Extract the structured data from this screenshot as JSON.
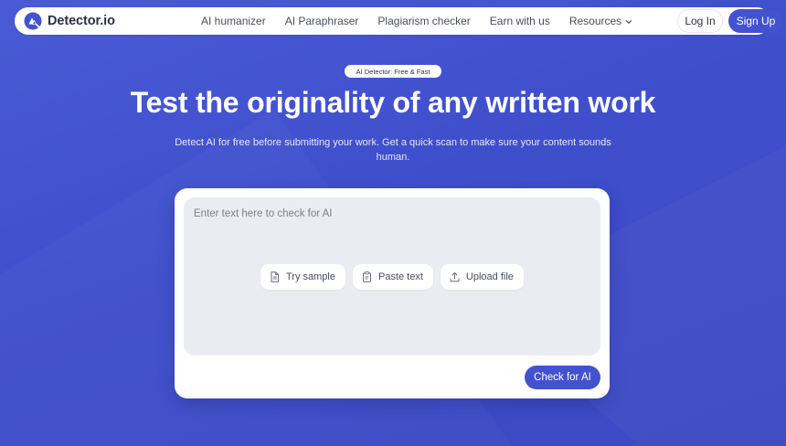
{
  "brand": {
    "name": "Detector.io",
    "logo_icon": "shield-magnifier-logo-icon"
  },
  "nav": {
    "links": [
      {
        "label": "AI humanizer"
      },
      {
        "label": "AI Paraphraser"
      },
      {
        "label": "Plagiarism checker"
      },
      {
        "label": "Earn with us"
      },
      {
        "label": "Resources",
        "icon": "chevron-down-icon"
      }
    ],
    "login_label": "Log In",
    "signup_label": "Sign Up"
  },
  "hero": {
    "badge": "AI Detector: Free & Fast",
    "title": "Test the originality of any written work",
    "subtitle": "Detect AI for free before submitting your work. Get a quick scan to make sure your content sounds human."
  },
  "checker": {
    "input_value": "",
    "input_placeholder": "Enter text here to check for AI",
    "actions": [
      {
        "label": "Try sample",
        "icon": "document-icon"
      },
      {
        "label": "Paste text",
        "icon": "paste-icon"
      },
      {
        "label": "Upload file",
        "icon": "upload-icon"
      }
    ],
    "submit_label": "Check for AI"
  },
  "colors": {
    "background": "#4352cf",
    "accent": "#4352cf",
    "text_dark": "#2d2f4a",
    "input_bg": "#ebecf1"
  }
}
